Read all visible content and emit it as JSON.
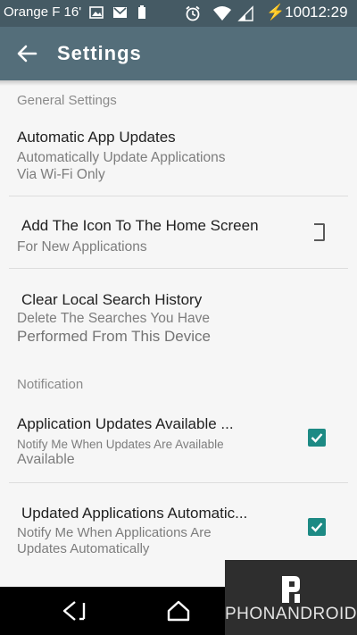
{
  "status_bar": {
    "carrier": "Orange F 16'",
    "signal_text": "⚡100",
    "time": "12:29",
    "icons": [
      "image-icon",
      "mail-icon",
      "battery-small-icon",
      "alarm-icon",
      "wifi-icon",
      "signal-icon"
    ]
  },
  "app_bar": {
    "back_icon": "arrow-left-icon",
    "title": "Settings"
  },
  "sections": {
    "general": {
      "header": "General Settings"
    },
    "notification": {
      "header": "Notification"
    }
  },
  "prefs": {
    "auto_updates": {
      "title": "Automatic App Updates",
      "summary_line1": "Automatically Update Applications",
      "summary_line2": "Via Wi-Fi Only"
    },
    "home_icon": {
      "title": "Add The Icon To The Home Screen",
      "summary": "For New Applications",
      "checked": false
    },
    "clear_history": {
      "title": "Clear Local Search History",
      "summary_line1": "Delete The Searches You Have",
      "summary_line2": "Performed From This Device"
    },
    "updates_available": {
      "title": "Application Updates Available ...",
      "summary_line1": "Notify Me When Updates Are Available",
      "summary_line2": "Available",
      "checked": true
    },
    "updated_auto": {
      "title": "Updated Applications Automatic...",
      "summary_line1": "Notify Me When Applications Are",
      "summary_line2": "Updates Automatically",
      "checked": true
    }
  },
  "nav_bar": {
    "back_icon": "nav-back-icon",
    "home_icon": "nav-home-icon"
  },
  "watermark": {
    "text": "PHONANDROID",
    "logo_icon": "phonandroid-logo-icon"
  },
  "colors": {
    "status_bar": "#455a64",
    "app_bar": "#546e7a",
    "accent": "#1d8a84",
    "background": "#f6f6f6"
  }
}
